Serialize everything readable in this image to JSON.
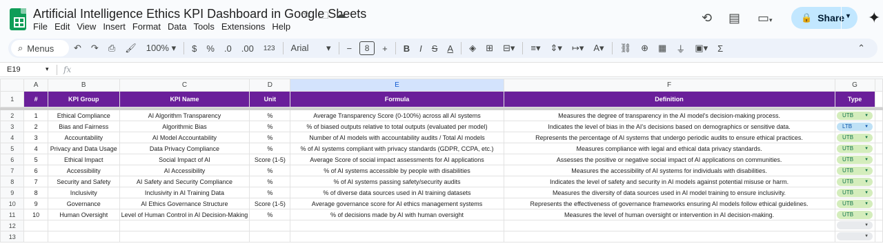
{
  "doc": {
    "title": "Artificial Intelligence Ethics KPI Dashboard in Google Sheets",
    "menu": [
      "File",
      "Edit",
      "View",
      "Insert",
      "Format",
      "Data",
      "Tools",
      "Extensions",
      "Help"
    ],
    "share_label": "Share"
  },
  "toolbar": {
    "menus_label": "Menus",
    "zoom": "100%",
    "currency": "$",
    "percent": "%",
    "dec_dec": ".0",
    "dec_inc": ".00",
    "number_format": "123",
    "font": "Arial",
    "font_size": "8",
    "bold": "B",
    "italic": "I",
    "text_color": "A"
  },
  "formula_bar": {
    "name_box": "E19",
    "fx": "fx",
    "value": ""
  },
  "columns": [
    "A",
    "B",
    "C",
    "D",
    "E",
    "F",
    "G"
  ],
  "header": [
    "#",
    "KPI Group",
    "KPI Name",
    "Unit",
    "Formula",
    "Definition",
    "Type"
  ],
  "rows": [
    {
      "n": "1",
      "group": "Ethical Compliance",
      "name": "AI Algorithm Transparency",
      "unit": "%",
      "formula": "Average Transparency Score (0-100%) across all AI systems",
      "definition": "Measures the degree of transparency in the AI model's decision-making process.",
      "type": "UTB"
    },
    {
      "n": "2",
      "group": "Bias and Fairness",
      "name": "Algorithmic Bias",
      "unit": "%",
      "formula": "% of biased outputs relative to total outputs (evaluated per model)",
      "definition": "Indicates the level of bias in the AI's decisions based on demographics or sensitive data.",
      "type": "LTB"
    },
    {
      "n": "3",
      "group": "Accountability",
      "name": "AI Model Accountability",
      "unit": "%",
      "formula": "Number of AI models with accountability audits / Total AI models",
      "definition": "Represents the percentage of AI systems that undergo periodic audits to ensure ethical practices.",
      "type": "UTB"
    },
    {
      "n": "4",
      "group": "Privacy and Data Usage",
      "name": "Data Privacy Compliance",
      "unit": "%",
      "formula": "% of AI systems compliant with privacy standards (GDPR, CCPA, etc.)",
      "definition": "Measures compliance with legal and ethical data privacy standards.",
      "type": "UTB"
    },
    {
      "n": "5",
      "group": "Ethical Impact",
      "name": "Social Impact of AI",
      "unit": "Score (1-5)",
      "formula": "Average Score of social impact assessments for AI applications",
      "definition": "Assesses the positive or negative social impact of AI applications on communities.",
      "type": "UTB"
    },
    {
      "n": "6",
      "group": "Accessibility",
      "name": "AI Accessibility",
      "unit": "%",
      "formula": "% of AI systems accessible by people with disabilities",
      "definition": "Measures the accessibility of AI systems for individuals with disabilities.",
      "type": "UTB"
    },
    {
      "n": "7",
      "group": "Security and Safety",
      "name": "AI Safety and Security Compliance",
      "unit": "%",
      "formula": "% of AI systems passing safety/security audits",
      "definition": "Indicates the level of safety and security in AI models against potential misuse or harm.",
      "type": "UTB"
    },
    {
      "n": "8",
      "group": "Inclusivity",
      "name": "Inclusivity in AI Training Data",
      "unit": "%",
      "formula": "% of diverse data sources used in AI training datasets",
      "definition": "Measures the diversity of data sources used in AI model training to ensure inclusivity.",
      "type": "UTB"
    },
    {
      "n": "9",
      "group": "Governance",
      "name": "AI Ethics Governance Structure",
      "unit": "Score (1-5)",
      "formula": "Average governance score for AI ethics management systems",
      "definition": "Represents the effectiveness of governance frameworks ensuring AI models follow ethical guidelines.",
      "type": "UTB"
    },
    {
      "n": "10",
      "group": "Human Oversight",
      "name": "Level of Human Control in AI Decision-Making",
      "unit": "%",
      "formula": "% of decisions made by AI with human oversight",
      "definition": "Measures the level of human oversight or intervention in AI decision-making.",
      "type": "UTB"
    }
  ],
  "row_numbers": [
    "1",
    "2",
    "3",
    "4",
    "5",
    "6",
    "7",
    "8",
    "9",
    "10",
    "11",
    "12",
    "13"
  ],
  "colors": {
    "header_bg": "#6a1f9a",
    "utb_chip": "#d4edbc",
    "ltb_chip": "#bfe1f6",
    "share_bg": "#c2e7ff"
  }
}
